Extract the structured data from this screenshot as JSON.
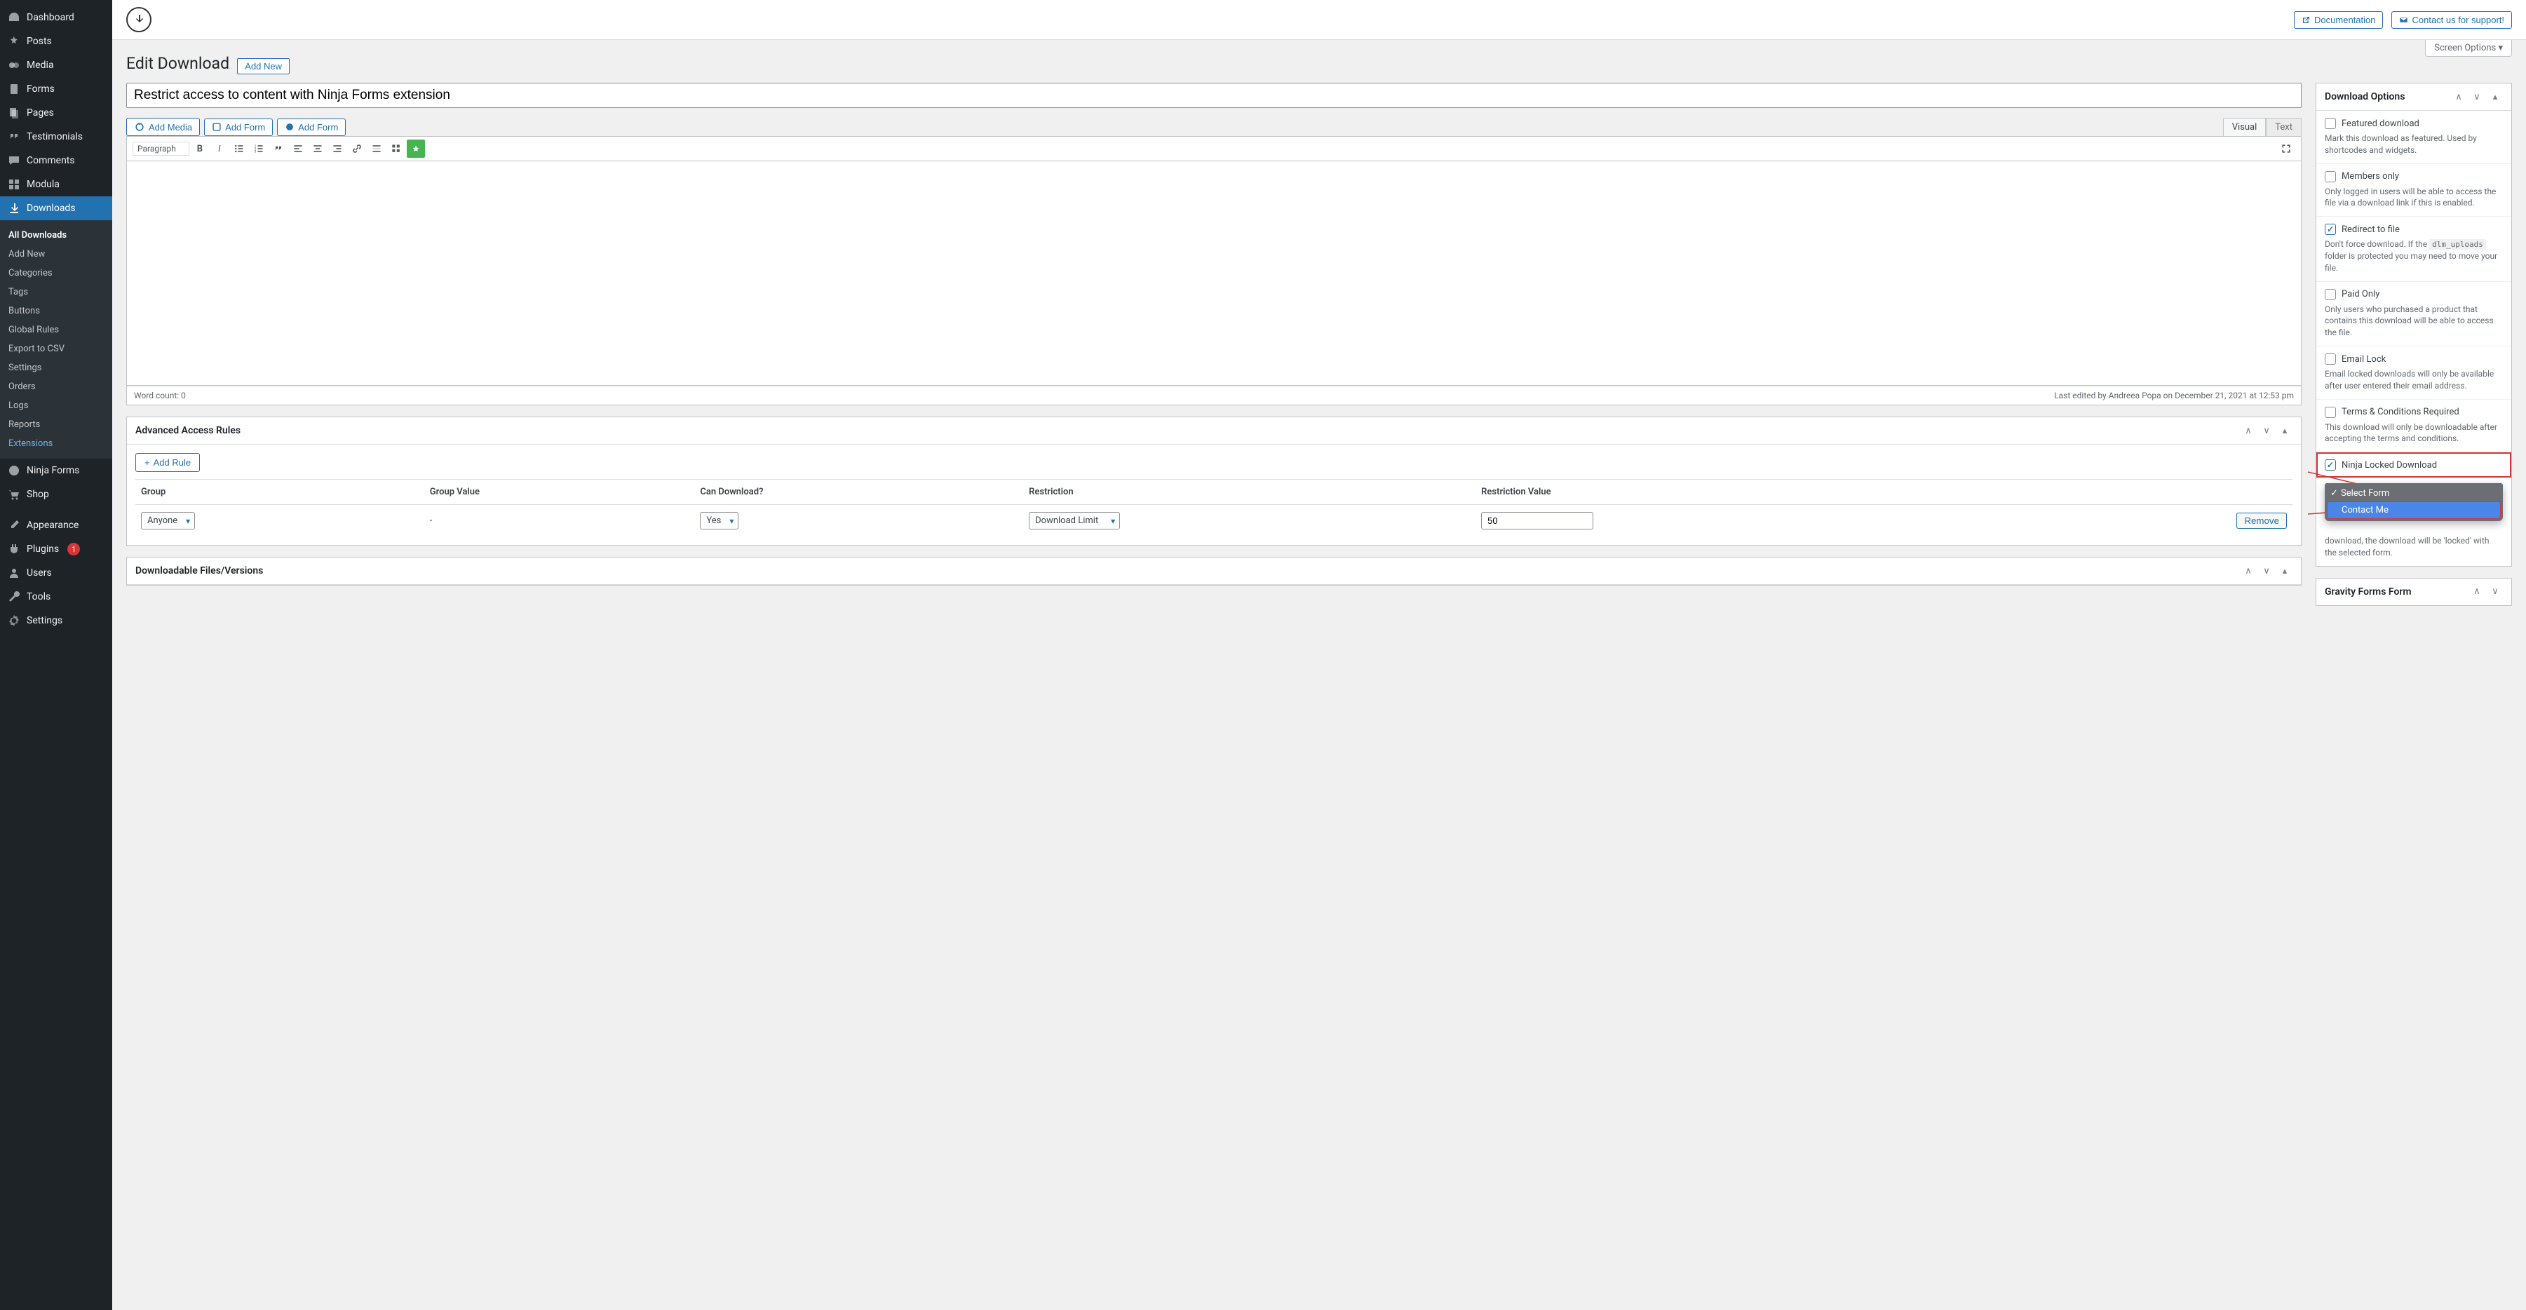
{
  "sidebar": {
    "items": [
      {
        "label": "Dashboard",
        "icon": "gauge"
      },
      {
        "label": "Posts",
        "icon": "pin"
      },
      {
        "label": "Media",
        "icon": "media"
      },
      {
        "label": "Forms",
        "icon": "file"
      },
      {
        "label": "Pages",
        "icon": "page"
      },
      {
        "label": "Testimonials",
        "icon": "quote"
      },
      {
        "label": "Comments",
        "icon": "chat"
      },
      {
        "label": "Modula",
        "icon": "grid"
      },
      {
        "label": "Downloads",
        "icon": "download",
        "active": true
      },
      {
        "label": "Ninja Forms",
        "icon": "ninja"
      },
      {
        "label": "Shop",
        "icon": "cart"
      },
      {
        "label": "Appearance",
        "icon": "brush"
      },
      {
        "label": "Plugins",
        "icon": "plug",
        "badge": "1"
      },
      {
        "label": "Users",
        "icon": "user"
      },
      {
        "label": "Tools",
        "icon": "wrench"
      },
      {
        "label": "Settings",
        "icon": "gear"
      }
    ],
    "sub": [
      "All Downloads",
      "Add New",
      "Categories",
      "Tags",
      "Buttons",
      "Global Rules",
      "Export to CSV",
      "Settings",
      "Orders",
      "Logs",
      "Reports",
      "Extensions"
    ]
  },
  "topbar": {
    "documentation": "Documentation",
    "support": "Contact us for support!"
  },
  "screen_options": "Screen Options",
  "page_title": "Edit Download",
  "add_new": "Add New",
  "title_value": "Restrict access to content with Ninja Forms extension",
  "editor": {
    "add_media": "Add Media",
    "add_form": "Add Form",
    "add_form2": "Add Form",
    "tab_visual": "Visual",
    "tab_text": "Text",
    "format_select": "Paragraph",
    "word_count_label": "Word count: 0",
    "last_edited": "Last edited by Andreea Popa on December 21, 2021 at 12:53 pm"
  },
  "rules": {
    "title": "Advanced Access Rules",
    "add_rule": "Add Rule",
    "cols": {
      "group": "Group",
      "group_value": "Group Value",
      "can_download": "Can Download?",
      "restriction": "Restriction",
      "restriction_value": "Restriction Value"
    },
    "row": {
      "group": "Anyone",
      "group_value": "-",
      "can_download": "Yes",
      "restriction": "Download Limit",
      "restriction_value": "50"
    },
    "remove": "Remove"
  },
  "files_box": {
    "title": "Downloadable Files/Versions"
  },
  "side": {
    "title": "Download Options",
    "featured": {
      "label": "Featured download",
      "desc": "Mark this download as featured. Used by shortcodes and widgets."
    },
    "members": {
      "label": "Members only",
      "desc": "Only logged in users will be able to access the file via a download link if this is enabled."
    },
    "redirect": {
      "label": "Redirect to file",
      "checked": true,
      "desc_a": "Don't force download. If the ",
      "desc_code": "dlm_uploads",
      "desc_b": " folder is protected you may need to move your file."
    },
    "paid": {
      "label": "Paid Only",
      "desc": "Only users who purchased a product that contains this download will be able to access the file."
    },
    "email": {
      "label": "Email Lock",
      "desc": "Email locked downloads will only be available after user entered their email address."
    },
    "terms": {
      "label": "Terms & Conditions Required",
      "desc": "This download will only be downloadable after accepting the terms and conditions."
    },
    "ninja": {
      "label": "Ninja Locked Download",
      "checked": true
    },
    "dropdown": {
      "selected": "Select Form",
      "option": "Contact Me",
      "help": "download, the download will be 'locked' with the selected form."
    },
    "gravity": {
      "title": "Gravity Forms Form"
    }
  }
}
